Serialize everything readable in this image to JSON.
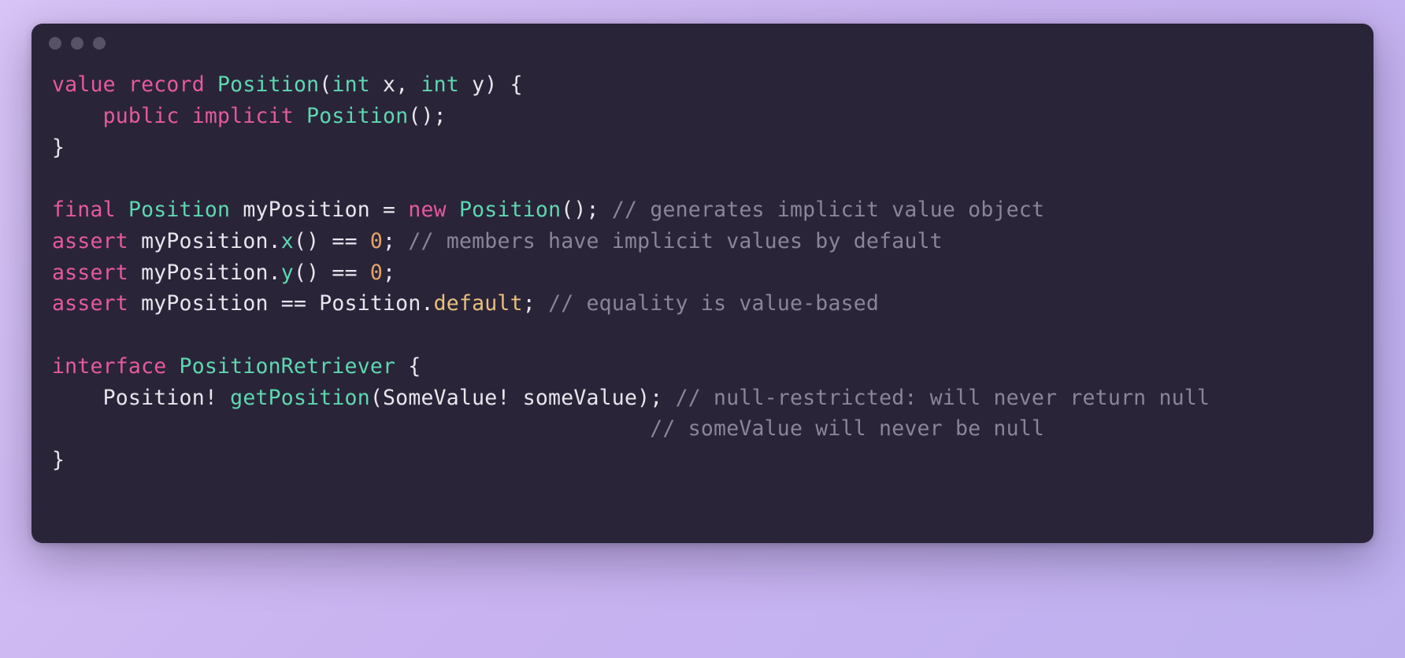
{
  "code": {
    "l1": {
      "kw1": "value",
      "kw2": "record",
      "type": "Position",
      "sig": "(",
      "ptype1": "int",
      "p1": " x, ",
      "ptype2": "int",
      "p2": " y) {"
    },
    "l2": {
      "indent": "    ",
      "kw1": "public",
      "kw2": "implicit",
      "type": "Position",
      "rest": "();"
    },
    "l3": {
      "text": "}"
    },
    "l5": {
      "kw1": "final",
      "type": "Position",
      "mid1": " myPosition = ",
      "kw2": "new",
      "type2": "Position",
      "rest": "(); ",
      "cm": "// generates implicit value object"
    },
    "l6": {
      "kw": "assert",
      "mid": " myPosition.",
      "fn": "x",
      "rest1": "() == ",
      "num": "0",
      "rest2": "; ",
      "cm": "// members have implicit values by default"
    },
    "l7": {
      "kw": "assert",
      "mid": " myPosition.",
      "fn": "y",
      "rest1": "() == ",
      "num": "0",
      "rest2": ";"
    },
    "l8": {
      "kw": "assert",
      "mid": " myPosition == Position.",
      "lit": "default",
      "rest": "; ",
      "cm": "// equality is value-based"
    },
    "l10": {
      "kw": "interface",
      "type": "PositionRetriever",
      "rest": " {"
    },
    "l11": {
      "indent": "    ",
      "sigA": "Position! ",
      "fn": "getPosition",
      "sigB": "(SomeValue! someValue); ",
      "cm": "// null-restricted: will never return null"
    },
    "l12": {
      "indent": "                                               ",
      "cm": "// someValue will never be null"
    },
    "l13": {
      "text": "}"
    }
  }
}
